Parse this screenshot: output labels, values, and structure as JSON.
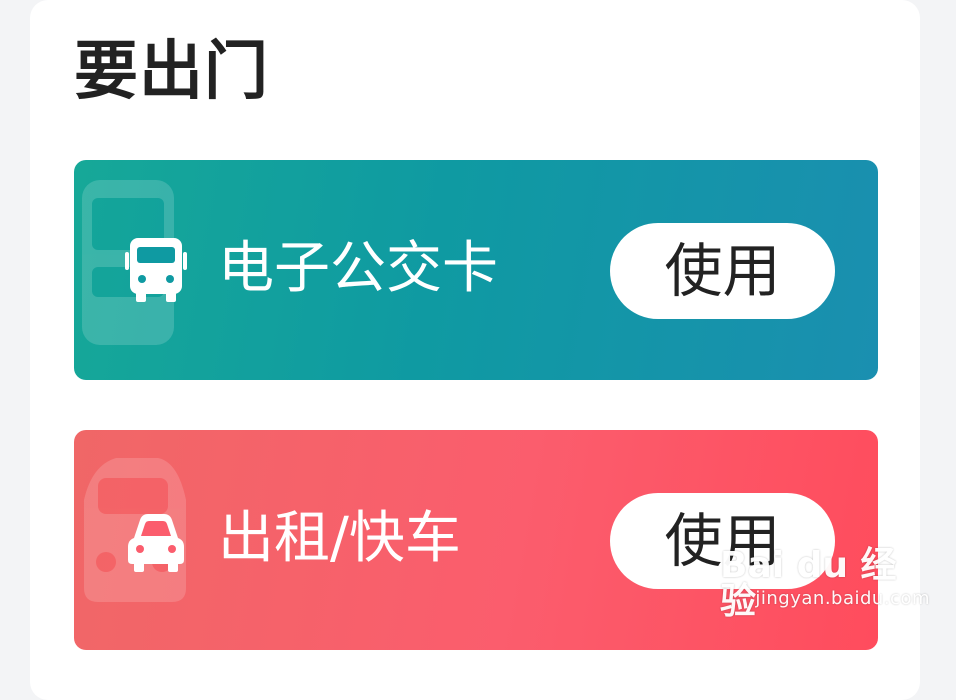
{
  "section": {
    "title": "要出门"
  },
  "cards": [
    {
      "label": "电子公交卡",
      "button_label": "使用",
      "icon": "bus-icon",
      "colors": [
        "#16a898",
        "#1a8fb0"
      ]
    },
    {
      "label": "出租/快车",
      "button_label": "使用",
      "icon": "car-icon",
      "colors": [
        "#f06767",
        "#ff4c5d"
      ]
    }
  ],
  "watermark": {
    "logo_text": "Bai du 经验",
    "url": "jingyan.baidu.com"
  }
}
